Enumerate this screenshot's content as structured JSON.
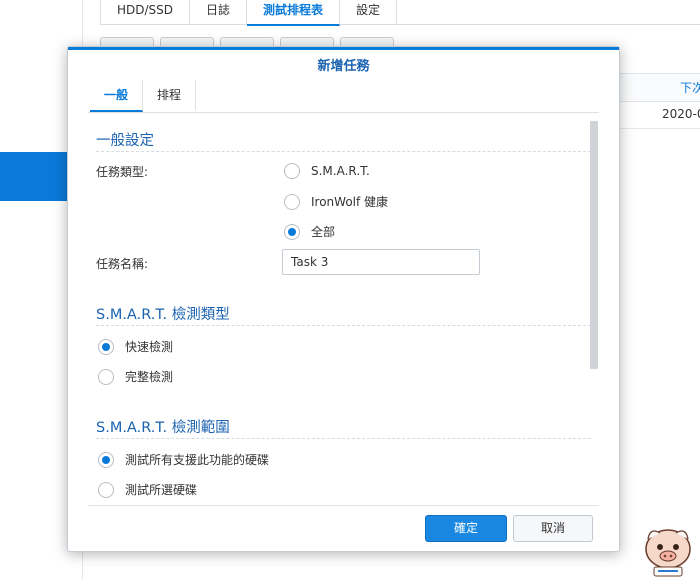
{
  "background": {
    "tabs": [
      "HDD/SSD",
      "日誌",
      "測試排程表",
      "設定"
    ],
    "active_tab": 2,
    "table_header": "下次",
    "table_cell": "2020-0"
  },
  "dialog": {
    "title": "新增任務",
    "tabs": [
      {
        "label": "一般",
        "active": true
      },
      {
        "label": "排程",
        "active": false
      }
    ],
    "general": {
      "section_title": "一般設定",
      "task_type_label": "任務類型:",
      "task_type_options": [
        {
          "label": "S.M.A.R.T.",
          "checked": false
        },
        {
          "label": "IronWolf 健康",
          "checked": false
        },
        {
          "label": "全部",
          "checked": true
        }
      ],
      "task_name_label": "任務名稱:",
      "task_name_value": "Task 3"
    },
    "smart_type": {
      "section_title": "S.M.A.R.T. 檢測類型",
      "options": [
        {
          "label": "快速檢測",
          "checked": true
        },
        {
          "label": "完整檢測",
          "checked": false
        }
      ]
    },
    "smart_scope": {
      "section_title": "S.M.A.R.T. 檢測範圍",
      "options": [
        {
          "label": "測試所有支援此功能的硬碟",
          "checked": true
        },
        {
          "label": "測試所選硬碟",
          "checked": false
        }
      ]
    },
    "ok_label": "確定",
    "cancel_label": "取消"
  },
  "colors": {
    "accent": "#0a7ad9",
    "title_blue": "#1b63b0",
    "primary_button": "#1a88e2"
  },
  "icons": [
    "radio-button",
    "mascot-icon"
  ]
}
